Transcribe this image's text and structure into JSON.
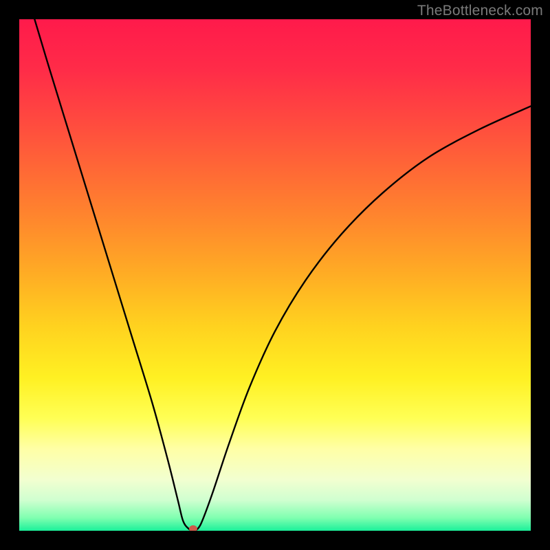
{
  "watermark": "TheBottleneck.com",
  "chart_data": {
    "type": "line",
    "title": "",
    "xlabel": "",
    "ylabel": "",
    "xlim": [
      0,
      100
    ],
    "ylim": [
      0,
      100
    ],
    "grid": false,
    "background_gradient": {
      "stops": [
        {
          "pos": 0.0,
          "color": "#ff1a4b"
        },
        {
          "pos": 0.1,
          "color": "#ff2c48"
        },
        {
          "pos": 0.2,
          "color": "#ff4a3f"
        },
        {
          "pos": 0.3,
          "color": "#ff6a35"
        },
        {
          "pos": 0.4,
          "color": "#ff8a2c"
        },
        {
          "pos": 0.5,
          "color": "#ffad24"
        },
        {
          "pos": 0.6,
          "color": "#ffd21f"
        },
        {
          "pos": 0.7,
          "color": "#fff022"
        },
        {
          "pos": 0.78,
          "color": "#ffff55"
        },
        {
          "pos": 0.84,
          "color": "#ffffa6"
        },
        {
          "pos": 0.9,
          "color": "#f2ffd0"
        },
        {
          "pos": 0.94,
          "color": "#d0ffd0"
        },
        {
          "pos": 0.975,
          "color": "#7fffb0"
        },
        {
          "pos": 1.0,
          "color": "#1bf09a"
        }
      ]
    },
    "series": [
      {
        "name": "bottleneck-curve",
        "color": "#000000",
        "x": [
          3.0,
          6.0,
          10.0,
          14.0,
          18.0,
          22.0,
          26.0,
          29.0,
          31.0,
          32.0,
          33.0,
          34.0,
          35.0,
          36.0,
          38.0,
          41.0,
          45.0,
          50.0,
          56.0,
          63.0,
          71.0,
          80.0,
          90.0,
          100.0
        ],
        "y": [
          100.0,
          90.0,
          77.0,
          64.0,
          51.0,
          38.0,
          25.0,
          14.0,
          6.0,
          2.0,
          0.5,
          0.0,
          0.5,
          2.5,
          8.0,
          17.0,
          28.0,
          39.0,
          49.0,
          58.0,
          66.0,
          73.0,
          78.5,
          83.0
        ]
      }
    ],
    "marker": {
      "name": "optimal-point",
      "x": 34.0,
      "y": 0.0,
      "color": "#cc5a4a",
      "rx": 6,
      "ry": 5
    }
  }
}
